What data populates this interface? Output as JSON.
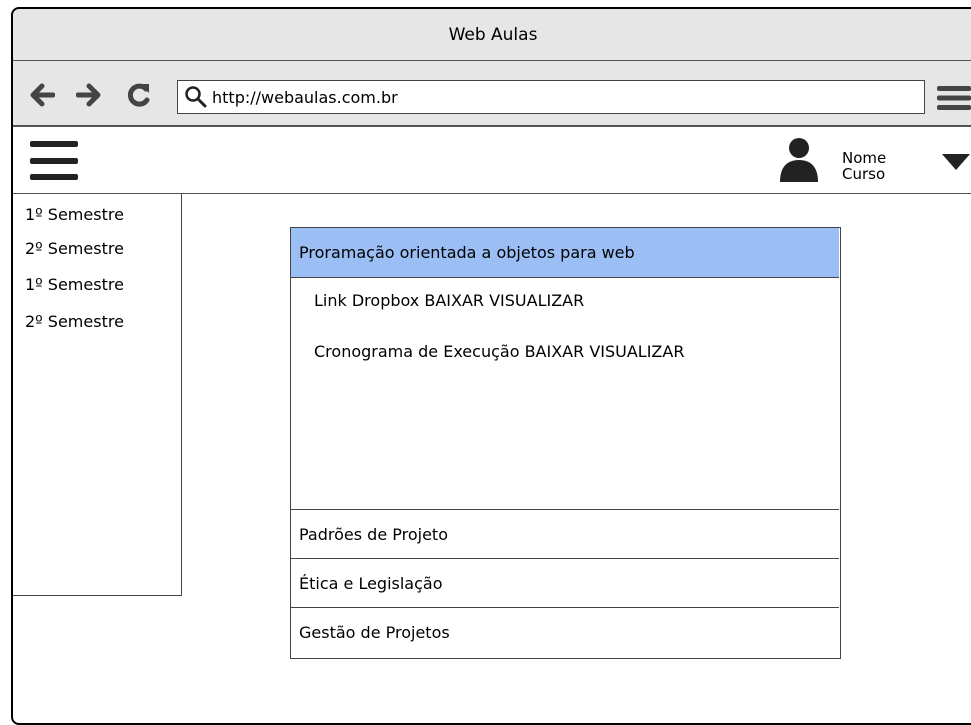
{
  "window": {
    "title": "Web Aulas"
  },
  "browser": {
    "url": "http://webaulas.com.br",
    "back_icon": "arrow-left-icon",
    "forward_icon": "arrow-right-icon",
    "reload_icon": "reload-icon",
    "search_icon": "magnifier-icon",
    "menu_icon": "hamburger-icon"
  },
  "header": {
    "user_name": "Nome",
    "user_course": "Curso",
    "avatar_icon": "user-icon",
    "caret_icon": "caret-down-icon"
  },
  "sidebar": {
    "items": [
      {
        "label": "1º Semestre"
      },
      {
        "label": "2º Semestre"
      },
      {
        "label": "1º Semestre"
      },
      {
        "label": "2º Semestre"
      }
    ]
  },
  "accordion": {
    "active": {
      "title": "Proramação orientada a objetos para web",
      "lines": [
        {
          "text": "Link Dropbox  BAIXAR VISUALIZAR"
        },
        {
          "text": "Cronograma de Execução BAIXAR VISUALIZAR"
        }
      ]
    },
    "sections": [
      {
        "title": "Padrões de Projeto"
      },
      {
        "title": "Ética e Legislação"
      },
      {
        "title": "Gestão de Projetos"
      }
    ]
  },
  "colors": {
    "active_header": "#9bbef5",
    "chrome": "#e6e6e6"
  }
}
